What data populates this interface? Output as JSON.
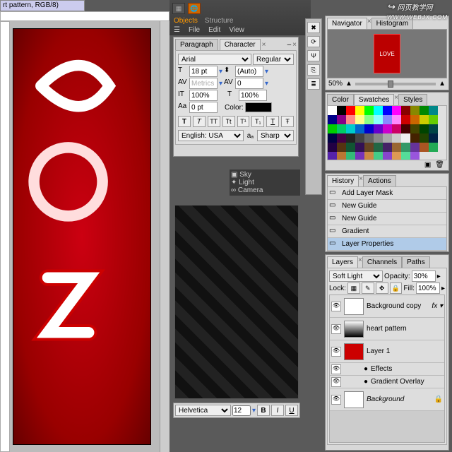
{
  "doc_title": "rt pattern, RGB/8)",
  "char_panel": {
    "tab_paragraph": "Paragraph",
    "tab_character": "Character",
    "font": "Arial",
    "style": "Regular",
    "size": "18 pt",
    "leading": "(Auto)",
    "tracking": "Metrics",
    "kerning": "0",
    "vscale": "100%",
    "hscale": "100%",
    "baseline": "0 pt",
    "color_label": "Color:",
    "lang": "English: USA",
    "aa": "Sharp"
  },
  "nav": {
    "tab1": "Navigator",
    "tab2": "Histogram",
    "zoom": "50%"
  },
  "topbar3d": {
    "objects": "Objects",
    "structure": "Structure",
    "file": "File",
    "edit": "Edit",
    "view": "View"
  },
  "scene": {
    "sky": "Sky",
    "light": "Light",
    "camera": "Camera"
  },
  "color": {
    "t1": "Color",
    "t2": "Swatches",
    "t3": "Styles"
  },
  "history": {
    "tab1": "History",
    "tab2": "Actions",
    "items": [
      "Add Layer Mask",
      "New Guide",
      "New Guide",
      "Gradient",
      "Layer Properties"
    ]
  },
  "layers": {
    "tabs": [
      "Layers",
      "Channels",
      "Paths"
    ],
    "blend": "Soft Light",
    "opacity_label": "Opacity:",
    "opacity": "30%",
    "lock_label": "Lock:",
    "fill_label": "Fill:",
    "fill": "100%",
    "items": [
      {
        "name": "Background copy",
        "fx": "fx"
      },
      {
        "name": "heart pattern"
      },
      {
        "name": "Layer 1"
      },
      {
        "name": "Effects",
        "indent": true
      },
      {
        "name": "Gradient Overlay",
        "indent": true
      },
      {
        "name": "Background",
        "locked": true
      }
    ]
  },
  "bottom_font": {
    "name": "Helvetica",
    "size": "12",
    "bold": "B",
    "italic": "I",
    "underline": "U"
  },
  "watermark": "网页教学网"
}
